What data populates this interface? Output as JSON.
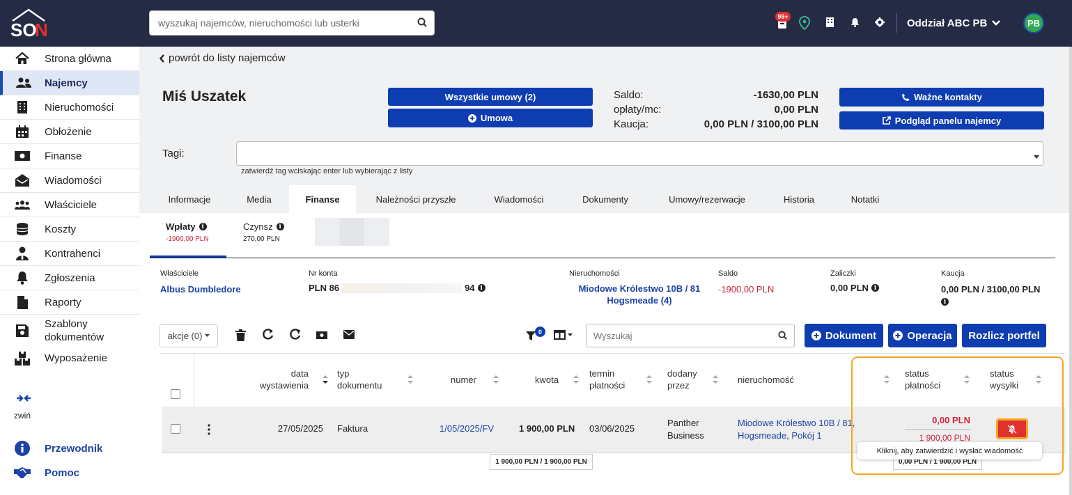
{
  "header": {
    "logo_text": "SON",
    "search_placeholder": "wyszukaj najemców, nieruchomości lub usterki",
    "notif_badge": "99+",
    "branch": "Oddział ABC PB",
    "avatar": "PB"
  },
  "sidebar": {
    "items": [
      {
        "label": "Strona główna"
      },
      {
        "label": "Najemcy"
      },
      {
        "label": "Nieruchomości"
      },
      {
        "label": "Obłożenie"
      },
      {
        "label": "Finanse"
      },
      {
        "label": "Wiadomości"
      },
      {
        "label": "Właściciele"
      },
      {
        "label": "Koszty"
      },
      {
        "label": "Kontrahenci"
      },
      {
        "label": "Zgłoszenia"
      },
      {
        "label": "Raporty"
      },
      {
        "label": "Szablony dokumentów"
      },
      {
        "label": "Wyposażenie"
      }
    ],
    "collapse": "zwiń",
    "guide": "Przewodnik",
    "help": "Pomoc"
  },
  "page": {
    "back": "powrót do listy najemców",
    "tenant_name": "Miś Uszatek",
    "btn_all_contracts": "Wszystkie umowy (2)",
    "btn_contract": "Umowa",
    "saldo_label": "Saldo:",
    "saldo_value": "-1630,00 PLN",
    "fees_label": "opłaty/mc:",
    "fees_value": "0,00 PLN",
    "deposit_label": "Kaucja:",
    "deposit_value": "0,00 PLN / 3100,00 PLN",
    "btn_contacts": "Ważne kontakty",
    "btn_panel": "Podgląd panelu najemcy",
    "tags_label": "Tagi:",
    "tags_hint": "zatwierdź tag wciskając enter lub wybierając z listy"
  },
  "tabs": [
    "Informacje",
    "Media",
    "Finanse",
    "Należności przyszłe",
    "Wiadomości",
    "Dokumenty",
    "Umowy/rezerwacje",
    "Historia",
    "Notatki"
  ],
  "subtabs": {
    "payments_label": "Wpłaty",
    "payments_value": "-1900,00 PLN",
    "rent_label": "Czynsz",
    "rent_value": "270,00 PLN"
  },
  "summary": {
    "owners_label": "Właściciele",
    "owner": "Albus Dumbledore",
    "account_label": "Nr konta",
    "account_prefix": "PLN 86",
    "account_suffix": "94",
    "property_label": "Nieruchomości",
    "property_line1": "Miodowe Królestwo 10B / 81",
    "property_line2": "Hogsmeade (4)",
    "balance_label": "Saldo",
    "balance_value": "-1900,00 PLN",
    "advances_label": "Zaliczki",
    "advances_value": "0,00 PLN",
    "deposit_label": "Kaucja",
    "deposit_value": "0,00 PLN / 3100,00 PLN"
  },
  "toolbar": {
    "actions": "akcje (0)",
    "filter_badge": "0",
    "search_placeholder": "Wyszukaj",
    "btn_document": "Dokument",
    "btn_operation": "Operacja",
    "btn_settle": "Rozlicz portfel"
  },
  "table": {
    "headers": {
      "date_1": "data",
      "date_2": "wystawienia",
      "type_1": "typ",
      "type_2": "dokumentu",
      "number": "numer",
      "amount": "kwota",
      "due_1": "termin",
      "due_2": "płatności",
      "added_1": "dodany",
      "added_2": "przez",
      "property": "nieruchomość",
      "pay_1": "status",
      "pay_2": "płatności",
      "send_1": "status",
      "send_2": "wysyłki"
    },
    "row": {
      "date": "27/05/2025",
      "type": "Faktura",
      "number": "1/05/2025/FV",
      "amount": "1 900,00 PLN",
      "due": "03/06/2025",
      "added_1": "Panther",
      "added_2": "Business",
      "property_1": "Miodowe Królestwo 10B / 81,",
      "property_2": "Hogsmeade, Pokój 1",
      "paid": "0,00 PLN",
      "total": "1 900,00 PLN"
    },
    "footer_amount": "1 900,00 PLN / 1 900,00 PLN",
    "footer_status": "0,00 PLN / 1 900,00 PLN",
    "tooltip": "Kliknij, aby zatwierdzić i wysłać wiadomość"
  },
  "colors": {
    "topbar": "#252b45",
    "accent": "#0d3db0",
    "negative": "#d0243a",
    "highlight": "#f5a623"
  }
}
